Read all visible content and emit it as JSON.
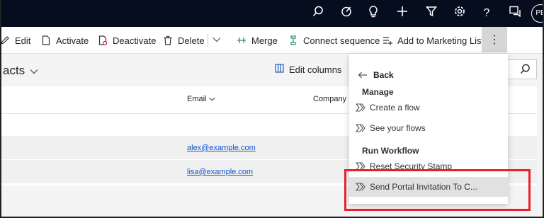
{
  "topbar": {
    "icons": [
      "search-icon",
      "target-icon",
      "lightbulb-icon",
      "plus-icon",
      "filter-icon",
      "gear-icon",
      "help-icon",
      "chat-icon"
    ],
    "avatar_initials": "PE"
  },
  "commands": {
    "edit": "Edit",
    "activate": "Activate",
    "deactivate": "Deactivate",
    "delete": "Delete",
    "merge": "Merge",
    "connect_sequence": "Connect sequence",
    "add_to_marketing_list": "Add to Marketing List",
    "more": "⋮"
  },
  "view": {
    "title": "acts",
    "edit_columns": "Edit columns"
  },
  "grid": {
    "columns": [
      "Email",
      "Company N"
    ],
    "rows": [
      {
        "email": "alex@example.com"
      },
      {
        "email": "lisa@example.com"
      }
    ]
  },
  "menu": {
    "back": "Back",
    "section_manage": "Manage",
    "create_flow": "Create a flow",
    "see_flows": "See your flows",
    "section_run": "Run Workflow",
    "reset_stamp": "Reset Security Stamp",
    "send_invitation": "Send Portal Invitation To C..."
  },
  "colors": {
    "topbar": "#050d1e",
    "highlight_border": "#e8202a",
    "link": "#1155cc"
  }
}
